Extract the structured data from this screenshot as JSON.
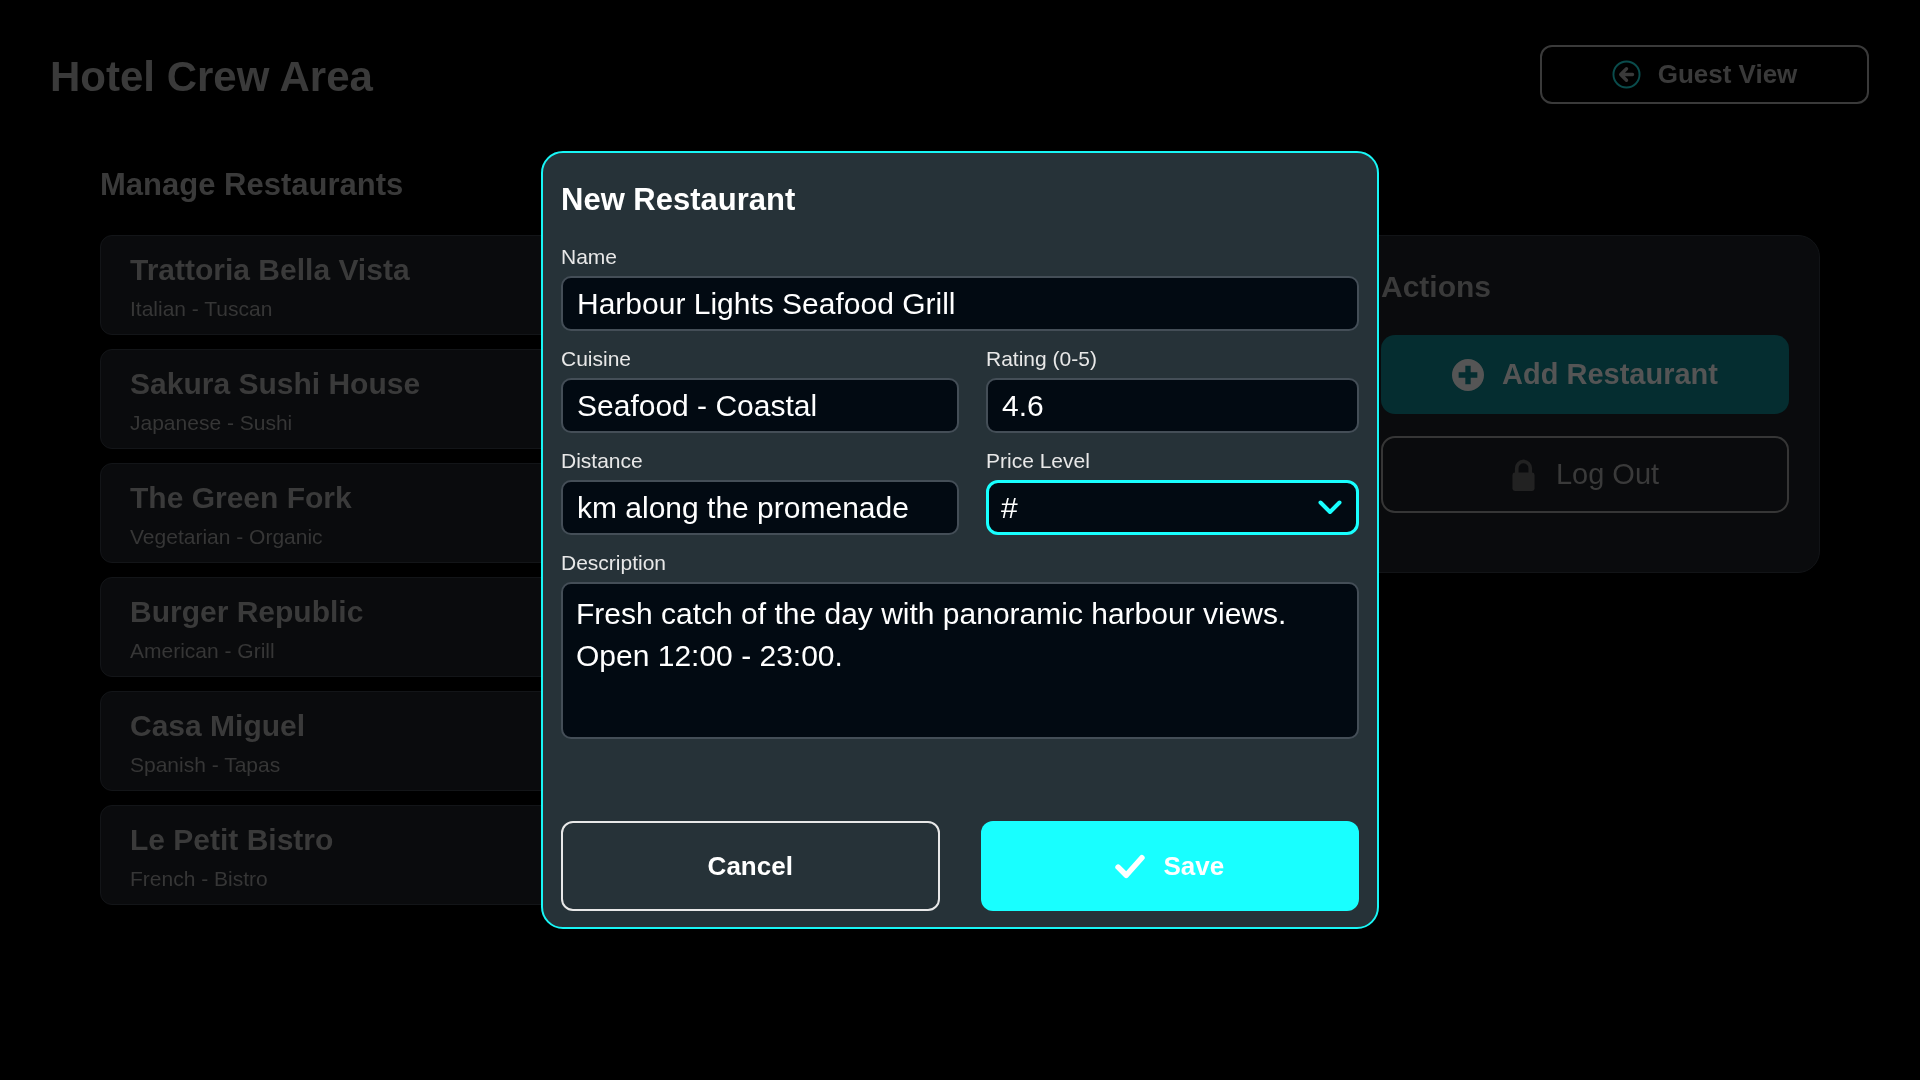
{
  "header": {
    "title": "Hotel Crew Area",
    "guest_view_button": {
      "label": "Guest View"
    }
  },
  "restaurants": {
    "title": "Manage Restaurants",
    "items": [
      {
        "name": "Trattoria Bella Vista",
        "cuisine": "Italian - Tuscan"
      },
      {
        "name": "Sakura Sushi House",
        "cuisine": "Japanese - Sushi"
      },
      {
        "name": "The Green Fork",
        "cuisine": "Vegetarian - Organic"
      },
      {
        "name": "Burger Republic",
        "cuisine": "American - Grill"
      },
      {
        "name": "Casa Miguel",
        "cuisine": "Spanish - Tapas"
      },
      {
        "name": "Le Petit Bistro",
        "cuisine": "French - Bistro"
      }
    ]
  },
  "actions": {
    "title": "Actions",
    "buttons": [
      {
        "label": "Add Restaurant",
        "kind": "primary"
      },
      {
        "label": "Log Out",
        "kind": "outline"
      }
    ]
  },
  "dialog": {
    "title": "New Restaurant",
    "rows": [
      [
        {
          "label": "Name",
          "kind": "text",
          "value": "Harbour Lights Seafood Grill",
          "focused": false
        }
      ],
      [
        {
          "label": "Cuisine",
          "kind": "text",
          "value": "Seafood - Coastal",
          "focused": false
        },
        {
          "label": "Rating (0-5)",
          "kind": "text",
          "value": "4.6",
          "focused": false
        }
      ],
      [
        {
          "label": "Distance",
          "kind": "text",
          "value": "km along the promenade",
          "focused": false
        },
        {
          "label": "Price Level",
          "kind": "select",
          "value": "#",
          "focused": true
        }
      ],
      [
        {
          "label": "Description",
          "kind": "textarea",
          "value": "Fresh catch of the day with panoramic harbour views. Open 12:00 - 23:00.",
          "focused": false
        }
      ]
    ],
    "buttons": [
      {
        "label": "Cancel",
        "kind": "outline"
      },
      {
        "label": "Save",
        "kind": "primary"
      }
    ]
  }
}
